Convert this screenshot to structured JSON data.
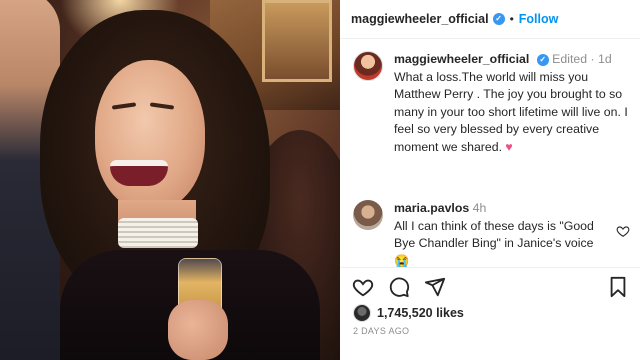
{
  "post": {
    "username": "maggiewheeler_official",
    "follow_label": "Follow",
    "separator": "•"
  },
  "caption": {
    "username": "maggiewheeler_official",
    "edited": "Edited",
    "dot": "·",
    "age": "1d",
    "text": "What a loss.The world will miss you Matthew Perry . The joy you brought to so many in your too short lifetime will live on. I feel so very blessed by every creative moment we shared.",
    "emoji": "♥"
  },
  "comment": {
    "username": "maria.pavlos",
    "age": "4h",
    "text": "All I can think of these days is \"Good Bye Chandler Bing\" in Janice's voice",
    "emoji": "😭"
  },
  "stats": {
    "likes": "1,745,520 likes",
    "posted": "2 DAYS AGO"
  },
  "icons": [
    "heart-icon",
    "comment-icon",
    "share-icon",
    "bookmark-icon",
    "verified-badge-icon"
  ],
  "colors": {
    "accent": "#0095f6",
    "verified": "#3897f0",
    "emoji_heart": "#ed4f8a",
    "muted": "#8e8e8e"
  }
}
